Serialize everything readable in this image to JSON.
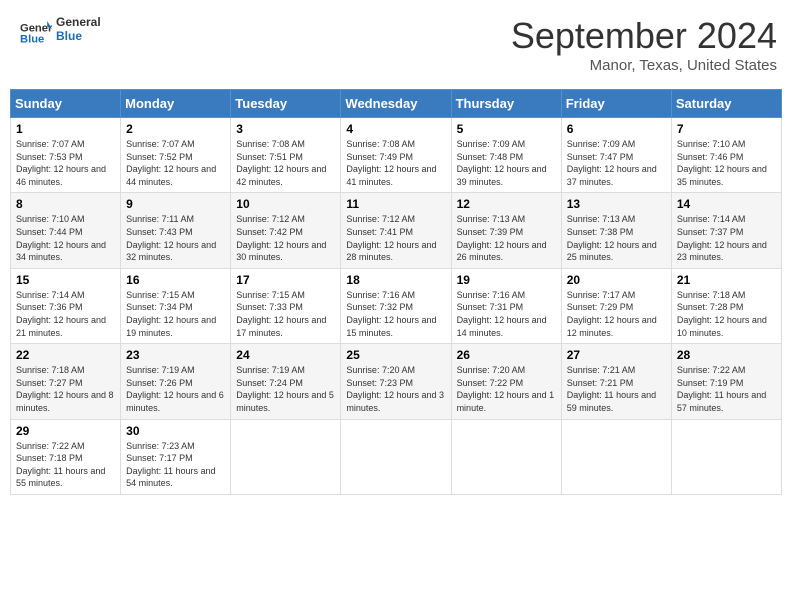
{
  "header": {
    "logo_general": "General",
    "logo_blue": "Blue",
    "title": "September 2024",
    "subtitle": "Manor, Texas, United States"
  },
  "columns": [
    "Sunday",
    "Monday",
    "Tuesday",
    "Wednesday",
    "Thursday",
    "Friday",
    "Saturday"
  ],
  "weeks": [
    [
      {
        "day": "1",
        "sunrise": "Sunrise: 7:07 AM",
        "sunset": "Sunset: 7:53 PM",
        "daylight": "Daylight: 12 hours and 46 minutes."
      },
      {
        "day": "2",
        "sunrise": "Sunrise: 7:07 AM",
        "sunset": "Sunset: 7:52 PM",
        "daylight": "Daylight: 12 hours and 44 minutes."
      },
      {
        "day": "3",
        "sunrise": "Sunrise: 7:08 AM",
        "sunset": "Sunset: 7:51 PM",
        "daylight": "Daylight: 12 hours and 42 minutes."
      },
      {
        "day": "4",
        "sunrise": "Sunrise: 7:08 AM",
        "sunset": "Sunset: 7:49 PM",
        "daylight": "Daylight: 12 hours and 41 minutes."
      },
      {
        "day": "5",
        "sunrise": "Sunrise: 7:09 AM",
        "sunset": "Sunset: 7:48 PM",
        "daylight": "Daylight: 12 hours and 39 minutes."
      },
      {
        "day": "6",
        "sunrise": "Sunrise: 7:09 AM",
        "sunset": "Sunset: 7:47 PM",
        "daylight": "Daylight: 12 hours and 37 minutes."
      },
      {
        "day": "7",
        "sunrise": "Sunrise: 7:10 AM",
        "sunset": "Sunset: 7:46 PM",
        "daylight": "Daylight: 12 hours and 35 minutes."
      }
    ],
    [
      {
        "day": "8",
        "sunrise": "Sunrise: 7:10 AM",
        "sunset": "Sunset: 7:44 PM",
        "daylight": "Daylight: 12 hours and 34 minutes."
      },
      {
        "day": "9",
        "sunrise": "Sunrise: 7:11 AM",
        "sunset": "Sunset: 7:43 PM",
        "daylight": "Daylight: 12 hours and 32 minutes."
      },
      {
        "day": "10",
        "sunrise": "Sunrise: 7:12 AM",
        "sunset": "Sunset: 7:42 PM",
        "daylight": "Daylight: 12 hours and 30 minutes."
      },
      {
        "day": "11",
        "sunrise": "Sunrise: 7:12 AM",
        "sunset": "Sunset: 7:41 PM",
        "daylight": "Daylight: 12 hours and 28 minutes."
      },
      {
        "day": "12",
        "sunrise": "Sunrise: 7:13 AM",
        "sunset": "Sunset: 7:39 PM",
        "daylight": "Daylight: 12 hours and 26 minutes."
      },
      {
        "day": "13",
        "sunrise": "Sunrise: 7:13 AM",
        "sunset": "Sunset: 7:38 PM",
        "daylight": "Daylight: 12 hours and 25 minutes."
      },
      {
        "day": "14",
        "sunrise": "Sunrise: 7:14 AM",
        "sunset": "Sunset: 7:37 PM",
        "daylight": "Daylight: 12 hours and 23 minutes."
      }
    ],
    [
      {
        "day": "15",
        "sunrise": "Sunrise: 7:14 AM",
        "sunset": "Sunset: 7:36 PM",
        "daylight": "Daylight: 12 hours and 21 minutes."
      },
      {
        "day": "16",
        "sunrise": "Sunrise: 7:15 AM",
        "sunset": "Sunset: 7:34 PM",
        "daylight": "Daylight: 12 hours and 19 minutes."
      },
      {
        "day": "17",
        "sunrise": "Sunrise: 7:15 AM",
        "sunset": "Sunset: 7:33 PM",
        "daylight": "Daylight: 12 hours and 17 minutes."
      },
      {
        "day": "18",
        "sunrise": "Sunrise: 7:16 AM",
        "sunset": "Sunset: 7:32 PM",
        "daylight": "Daylight: 12 hours and 15 minutes."
      },
      {
        "day": "19",
        "sunrise": "Sunrise: 7:16 AM",
        "sunset": "Sunset: 7:31 PM",
        "daylight": "Daylight: 12 hours and 14 minutes."
      },
      {
        "day": "20",
        "sunrise": "Sunrise: 7:17 AM",
        "sunset": "Sunset: 7:29 PM",
        "daylight": "Daylight: 12 hours and 12 minutes."
      },
      {
        "day": "21",
        "sunrise": "Sunrise: 7:18 AM",
        "sunset": "Sunset: 7:28 PM",
        "daylight": "Daylight: 12 hours and 10 minutes."
      }
    ],
    [
      {
        "day": "22",
        "sunrise": "Sunrise: 7:18 AM",
        "sunset": "Sunset: 7:27 PM",
        "daylight": "Daylight: 12 hours and 8 minutes."
      },
      {
        "day": "23",
        "sunrise": "Sunrise: 7:19 AM",
        "sunset": "Sunset: 7:26 PM",
        "daylight": "Daylight: 12 hours and 6 minutes."
      },
      {
        "day": "24",
        "sunrise": "Sunrise: 7:19 AM",
        "sunset": "Sunset: 7:24 PM",
        "daylight": "Daylight: 12 hours and 5 minutes."
      },
      {
        "day": "25",
        "sunrise": "Sunrise: 7:20 AM",
        "sunset": "Sunset: 7:23 PM",
        "daylight": "Daylight: 12 hours and 3 minutes."
      },
      {
        "day": "26",
        "sunrise": "Sunrise: 7:20 AM",
        "sunset": "Sunset: 7:22 PM",
        "daylight": "Daylight: 12 hours and 1 minute."
      },
      {
        "day": "27",
        "sunrise": "Sunrise: 7:21 AM",
        "sunset": "Sunset: 7:21 PM",
        "daylight": "Daylight: 11 hours and 59 minutes."
      },
      {
        "day": "28",
        "sunrise": "Sunrise: 7:22 AM",
        "sunset": "Sunset: 7:19 PM",
        "daylight": "Daylight: 11 hours and 57 minutes."
      }
    ],
    [
      {
        "day": "29",
        "sunrise": "Sunrise: 7:22 AM",
        "sunset": "Sunset: 7:18 PM",
        "daylight": "Daylight: 11 hours and 55 minutes."
      },
      {
        "day": "30",
        "sunrise": "Sunrise: 7:23 AM",
        "sunset": "Sunset: 7:17 PM",
        "daylight": "Daylight: 11 hours and 54 minutes."
      },
      null,
      null,
      null,
      null,
      null
    ]
  ]
}
